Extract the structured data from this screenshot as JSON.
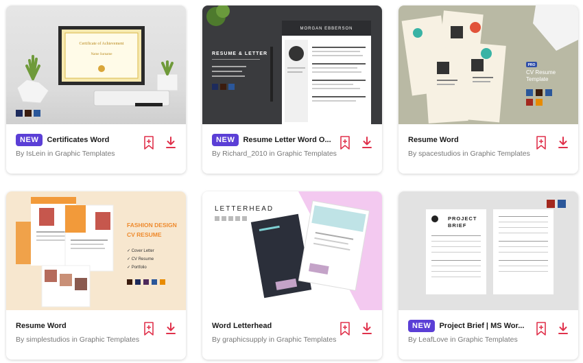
{
  "cards": [
    {
      "badge": "NEW",
      "title": "Certificates Word",
      "author": "By IsLein in Graphic Templates",
      "thumb": {
        "cert_heading": "Certificate of Achievement",
        "cert_name": "Name Surname"
      }
    },
    {
      "badge": "NEW",
      "title": "Resume Letter Word O...",
      "author": "By Richard_2010 in Graphic Templates",
      "thumb": {
        "name": "MORGAN EBBERSON",
        "heading": "RESUME & LETTER"
      }
    },
    {
      "badge": "",
      "title": "Resume Word",
      "author": "By spacestudios in Graphic Templates",
      "thumb": {
        "pro": "PRO",
        "heading": "CV Resume Template"
      }
    },
    {
      "badge": "",
      "title": "Resume Word",
      "author": "By simplestudios in Graphic Templates",
      "thumb": {
        "heading1": "FASHION DESIGN",
        "heading2": "CV RESUME",
        "bullets": [
          "Cover Letter",
          "CV Resume",
          "Portfolio"
        ]
      }
    },
    {
      "badge": "",
      "title": "Word Letterhead",
      "author": "By graphicsupply in Graphic Templates",
      "thumb": {
        "heading": "LETTERHEAD"
      }
    },
    {
      "badge": "NEW",
      "title": "Project Brief | MS Wor...",
      "author": "By LeafLove in Graphic Templates",
      "thumb": {
        "heading1": "PROJECT",
        "heading2": "BRIEF"
      }
    }
  ],
  "colors": {
    "accent": "#e0314b",
    "badge": "#5b3fd6"
  },
  "icons": {
    "bookmark": "bookmark-add-icon",
    "download": "download-icon"
  }
}
